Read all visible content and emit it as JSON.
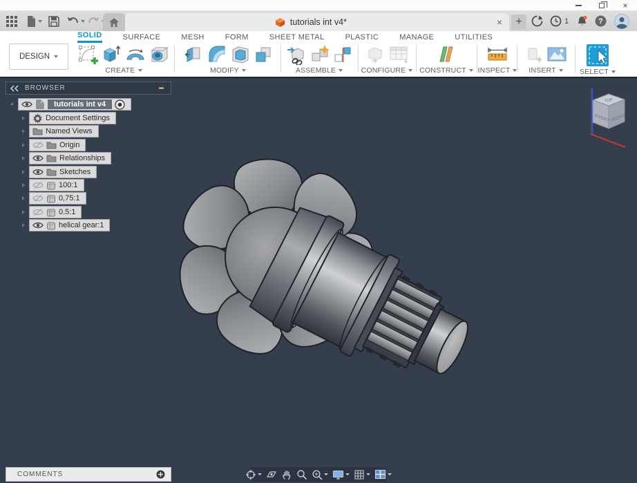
{
  "colors": {
    "accent_blue": "#0696D7",
    "viewport_bg": "#343E4C",
    "fusion_orange": "#F0622D",
    "selection_dark": "#646E79"
  },
  "glyphs": {
    "close_window": "×",
    "close_tab": "×",
    "new_tab": "+",
    "help": "?"
  },
  "tabbar": {
    "document_tab": "tutorials int v4*",
    "job_count": "1"
  },
  "workspace": {
    "label": "DESIGN"
  },
  "ribbon_tabs": [
    {
      "label": "SOLID",
      "active": true
    },
    {
      "label": "SURFACE"
    },
    {
      "label": "MESH"
    },
    {
      "label": "FORM"
    },
    {
      "label": "SHEET METAL"
    },
    {
      "label": "PLASTIC"
    },
    {
      "label": "MANAGE"
    },
    {
      "label": "UTILITIES"
    }
  ],
  "toolbar_groups": [
    {
      "label": "CREATE"
    },
    {
      "label": "MODIFY"
    },
    {
      "label": "ASSEMBLE"
    },
    {
      "label": "CONFIGURE"
    },
    {
      "label": "CONSTRUCT"
    },
    {
      "label": "INSPECT"
    },
    {
      "label": "INSERT"
    },
    {
      "label": "SELECT"
    }
  ],
  "browser": {
    "title": "BROWSER",
    "root_label": "tutorials int v4",
    "items": [
      {
        "label": "Document Settings",
        "icon": "gear",
        "visibility": "none"
      },
      {
        "label": "Named Views",
        "icon": "folder",
        "visibility": "none"
      },
      {
        "label": "Origin",
        "icon": "folder",
        "visibility": "hidden"
      },
      {
        "label": "Relationships",
        "icon": "folder",
        "visibility": "visible"
      },
      {
        "label": "Sketches",
        "icon": "folder",
        "visibility": "visible"
      },
      {
        "label": "100:1",
        "icon": "component",
        "visibility": "hidden"
      },
      {
        "label": "0,75:1",
        "icon": "component",
        "visibility": "hidden"
      },
      {
        "label": "0.5:1",
        "icon": "component",
        "visibility": "hidden"
      },
      {
        "label": "helical gear:1",
        "icon": "component",
        "visibility": "visible"
      }
    ]
  },
  "viewcube": {
    "top": "TOP",
    "front": "FRONT",
    "right": "RIGHT"
  },
  "comments": {
    "label": "COMMENTS"
  }
}
